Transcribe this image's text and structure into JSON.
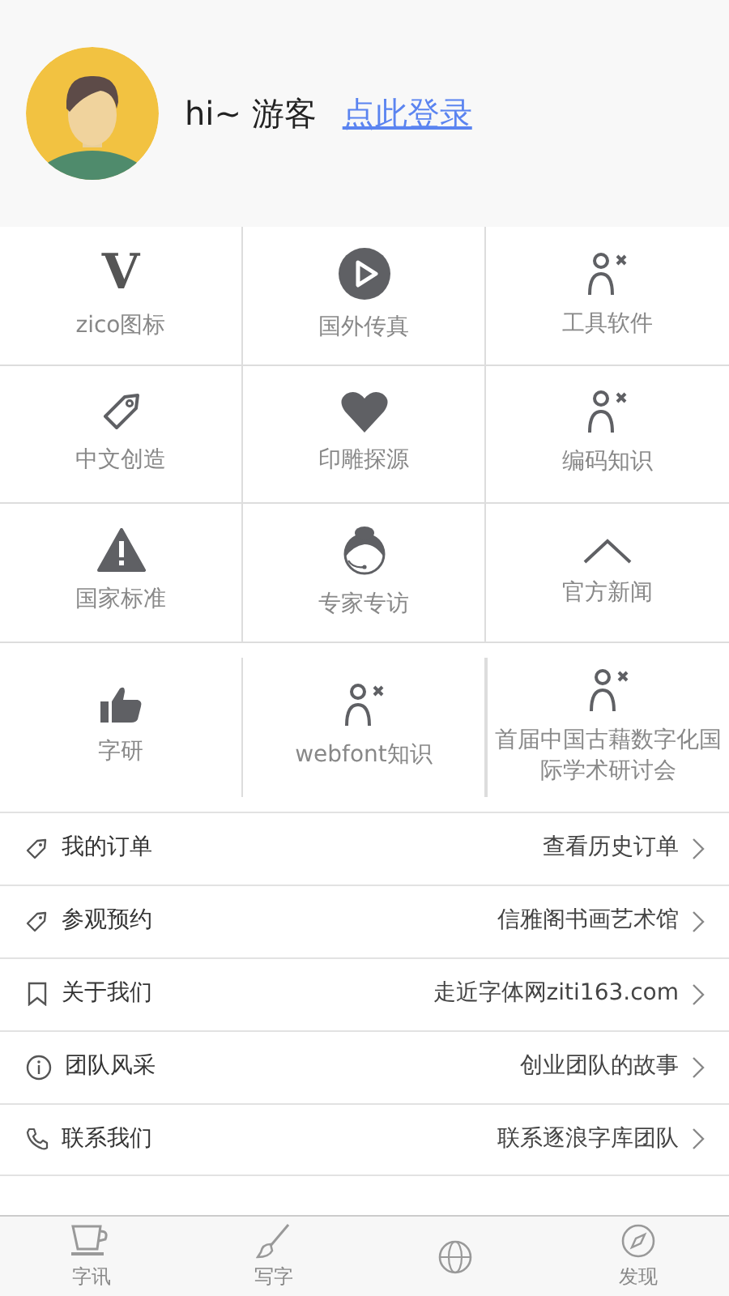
{
  "header": {
    "greeting": "hi~ 游客",
    "login_link": "点此登录"
  },
  "grid": [
    {
      "kind": "letter",
      "glyph": "V",
      "label": "zico图标"
    },
    {
      "kind": "play",
      "label": "国外传真"
    },
    {
      "kind": "person",
      "label": "工具软件"
    },
    {
      "kind": "tag",
      "label": "中文创造"
    },
    {
      "kind": "heart",
      "label": "印雕探源"
    },
    {
      "kind": "person",
      "label": "编码知识"
    },
    {
      "kind": "warning",
      "label": "国家标准"
    },
    {
      "kind": "headset",
      "label": "专家专访"
    },
    {
      "kind": "chevron",
      "label": "官方新闻"
    },
    {
      "kind": "thumb",
      "label": "字研"
    },
    {
      "kind": "person",
      "label": "webfont知识"
    },
    {
      "kind": "person",
      "label": "首届中国古藉数字化国际学术研讨会"
    }
  ],
  "menu": [
    {
      "kind": "tag",
      "label": "我的订单",
      "detail": "查看历史订单"
    },
    {
      "kind": "tag",
      "label": "参观预约",
      "detail": "信雅阁书画艺术馆"
    },
    {
      "kind": "bookmark",
      "label": "关于我们",
      "detail": "走近字体网ziti163.com"
    },
    {
      "kind": "info",
      "label": "团队风采",
      "detail": "创业团队的故事"
    },
    {
      "kind": "phone",
      "label": "联系我们",
      "detail": "联系逐浪字库团队"
    }
  ],
  "tabbar": [
    {
      "kind": "cup",
      "label": "字讯",
      "selected": false
    },
    {
      "kind": "brush",
      "label": "写字",
      "selected": false
    },
    {
      "kind": "globe",
      "selected": false
    },
    {
      "kind": "compass",
      "label": "发现",
      "selected": false
    }
  ]
}
